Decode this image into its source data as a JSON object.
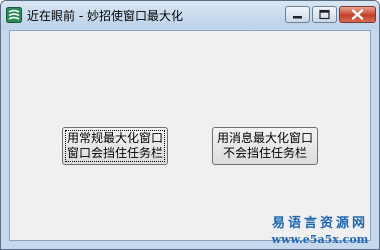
{
  "window": {
    "title": "近在眼前 - 妙招使窗口最大化",
    "app_icon": "app-logo-icon",
    "controls": {
      "minimize_icon": "minimize-icon",
      "maximize_icon": "maximize-icon",
      "close_icon": "close-icon"
    }
  },
  "buttons": {
    "normal_maximize": {
      "line1": "用常规最大化窗口",
      "line2": "窗口会挡住任务栏"
    },
    "message_maximize": {
      "line1": "用消息最大化窗口",
      "line2": "不会挡住任务栏"
    }
  },
  "watermark": {
    "title": "易语言资源网",
    "url": "www.e5a5x.com"
  },
  "colors": {
    "titlebar": "#c6d8ec",
    "client": "#f0f0f0",
    "close_button": "#c4412a",
    "watermark": "#1e66b0"
  }
}
